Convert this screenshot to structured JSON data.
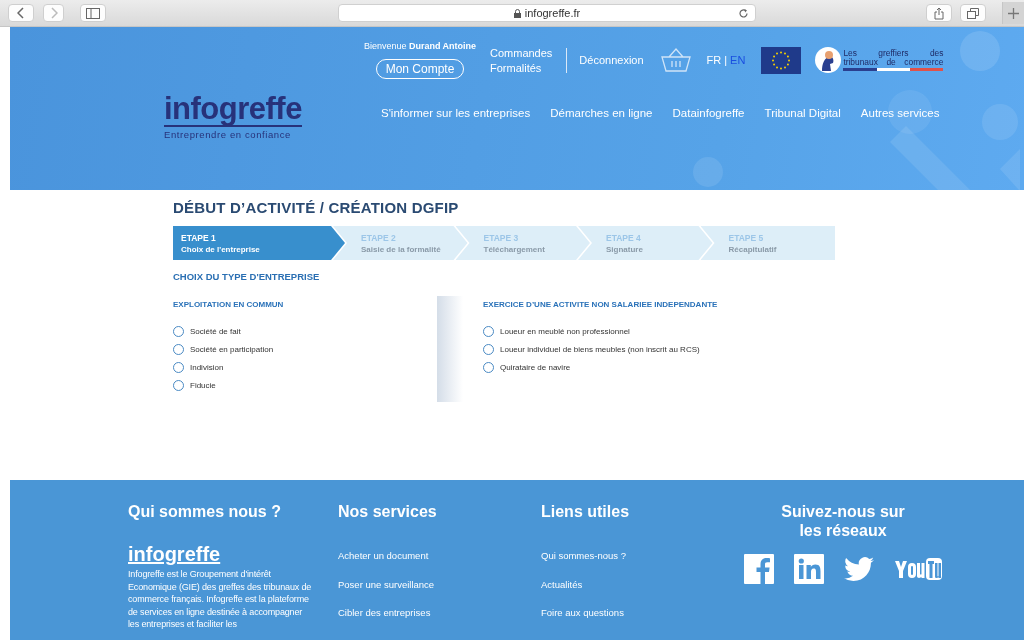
{
  "browser": {
    "url": "infogreffe.fr"
  },
  "header": {
    "logo": {
      "name": "infogreffe",
      "tagline": "Entreprendre en confiance"
    },
    "welcome": "Bienvenue **Durand Antoine**",
    "account_button": "Mon Compte",
    "links": [
      "Commandes",
      "Formalités"
    ],
    "logout": "Déconnexion",
    "languages": [
      {
        "label": "FR",
        "selected": true
      },
      {
        "label": "EN",
        "selected": false
      }
    ],
    "language_separator": "|",
    "partner": {
      "line_1": "Les greffiers des",
      "line_2": "tribunaux de commerce"
    },
    "nav": [
      "S'informer sur les entreprises",
      "Démarches en ligne",
      "Datainfogreffe",
      "Tribunal Digital",
      "Autres services"
    ]
  },
  "page": {
    "title": "DÉBUT D’ACTIVITÉ / CRÉATION DGFIP",
    "steps": [
      {
        "label": "ETAPE 1",
        "name": "Choix de l'entreprise",
        "selected": true
      },
      {
        "label": "ETAPE 2",
        "name": "Saisie de la formalité",
        "selected": false
      },
      {
        "label": "ETAPE 3",
        "name": "Téléchargement",
        "selected": false
      },
      {
        "label": "ETAPE 4",
        "name": "Signature",
        "selected": false
      },
      {
        "label": "ETAPE 5",
        "name": "Récapitulatif",
        "selected": false
      }
    ],
    "section_title": "CHOIX DU TYPE D'ENTREPRISE",
    "groups": [
      {
        "title": "EXPLOITATION EN COMMUN",
        "options": [
          {
            "label": "Société de fait",
            "checked": false
          },
          {
            "label": "Société en participation",
            "checked": false
          },
          {
            "label": "Indivision",
            "checked": false
          },
          {
            "label": "Fiducie",
            "checked": false
          }
        ]
      },
      {
        "title": "EXERCICE D’UNE ACTIVITE NON SALARIEE INDEPENDANTE",
        "options": [
          {
            "label": "Loueur en meublé non professionnel",
            "checked": false
          },
          {
            "label": "Loueur individuel de biens meubles (non inscrit au RCS)",
            "checked": false
          },
          {
            "label": "Quirataire de navire",
            "checked": false
          }
        ]
      }
    ]
  },
  "footer": {
    "about": {
      "title": "Qui sommes nous ?",
      "logo": "infogreffe",
      "text": "Infogreffe est le Groupement d'intérêt Economique (GIE) des greffes des tribunaux de commerce français. Infogreffe est la plateforme de services en ligne destinée à accompagner les entreprises et faciliter les"
    },
    "columns": [
      {
        "title": "Nos services",
        "links": [
          "Acheter un document",
          "Poser une surveillance",
          "Cibler des entreprises"
        ]
      },
      {
        "title": "Liens utiles",
        "links": [
          "Qui sommes-nous ?",
          "Actualités",
          "Foire aux questions"
        ]
      }
    ],
    "social": {
      "title": "Suivez-nous sur les réseaux",
      "networks": [
        {
          "kind": "facebook"
        },
        {
          "kind": "linkedin"
        },
        {
          "kind": "twitter"
        },
        {
          "kind": "youtube"
        }
      ]
    }
  }
}
